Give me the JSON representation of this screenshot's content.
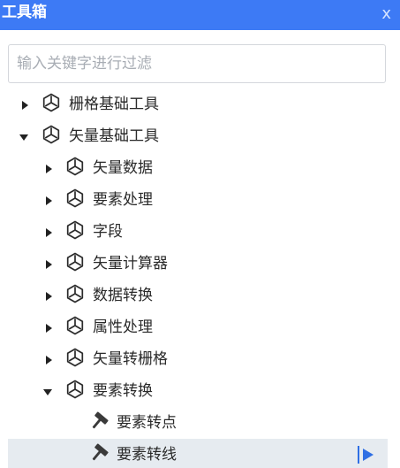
{
  "window": {
    "title": "工具箱",
    "close_label": "x",
    "accent_color": "#3d7af5"
  },
  "search": {
    "placeholder": "输入关键字进行过滤",
    "value": ""
  },
  "tree": [
    {
      "label": "栅格基础工具",
      "level": 0,
      "state": "collapsed",
      "icon": "package-icon"
    },
    {
      "label": "矢量基础工具",
      "level": 0,
      "state": "expanded",
      "icon": "package-icon"
    },
    {
      "label": "矢量数据",
      "level": 1,
      "state": "collapsed",
      "icon": "package-icon"
    },
    {
      "label": "要素处理",
      "level": 1,
      "state": "collapsed",
      "icon": "package-icon"
    },
    {
      "label": "字段",
      "level": 1,
      "state": "collapsed",
      "icon": "package-icon"
    },
    {
      "label": "矢量计算器",
      "level": 1,
      "state": "collapsed",
      "icon": "package-icon"
    },
    {
      "label": "数据转换",
      "level": 1,
      "state": "collapsed",
      "icon": "package-icon"
    },
    {
      "label": "属性处理",
      "level": 1,
      "state": "collapsed",
      "icon": "package-icon"
    },
    {
      "label": "矢量转栅格",
      "level": 1,
      "state": "collapsed",
      "icon": "package-icon"
    },
    {
      "label": "要素转换",
      "level": 1,
      "state": "expanded",
      "icon": "package-icon"
    },
    {
      "label": "要素转点",
      "level": 2,
      "state": "leaf",
      "icon": "hammer-icon"
    },
    {
      "label": "要素转线",
      "level": 2,
      "state": "leaf",
      "icon": "hammer-icon",
      "selected": true,
      "action_icon": "run-icon"
    }
  ]
}
